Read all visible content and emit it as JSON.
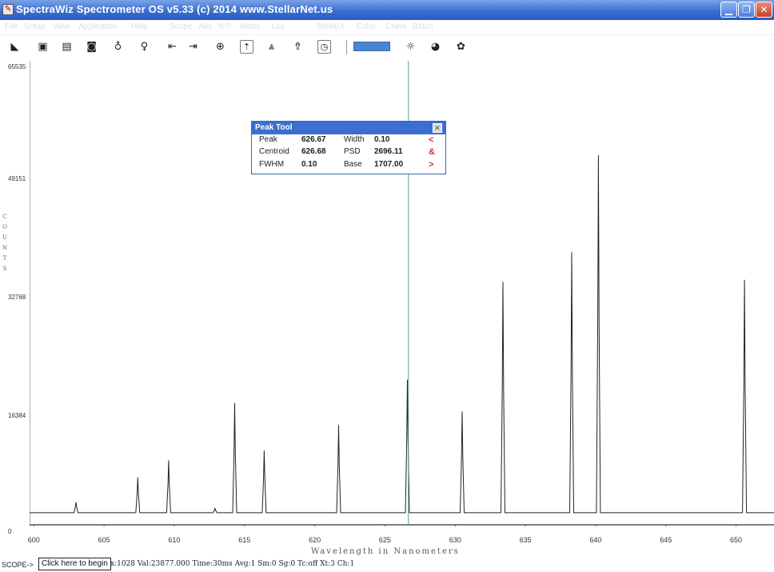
{
  "window": {
    "title": "SpectraWiz  Spectrometer OS v5.33 (c) 2014    www.StellarNet.us",
    "app_icon": "spectrawiz-icon",
    "controls": [
      "minimize-icon",
      "restore-icon",
      "close-icon"
    ]
  },
  "menu": {
    "items": [
      "File",
      "Setup",
      "View",
      "Application",
      "Help",
      "Scope",
      "Abs",
      "%Tr",
      "Watts",
      "Lux",
      "StellarX",
      "Color",
      "Chem",
      "Batch"
    ]
  },
  "toolbar": {
    "icons": [
      "open-file-icon",
      "save-icon",
      "print-icon",
      "camera-icon",
      "lamp-icon",
      "bulb-icon",
      "cursor-left-icon",
      "cursor-right-icon",
      "zoom-icon",
      "autoscale-y-icon",
      "peak-icon",
      "autoscale-icon",
      "timer-icon",
      "color-bar-icon",
      "sun-icon",
      "color-wheel-icon",
      "paint-icon"
    ]
  },
  "chart": {
    "ytick_labels": [
      "65535",
      "49151",
      "32768",
      "16384",
      "0"
    ],
    "ylabel_letters": "C\nO\nU\nN\nT\nS",
    "xtick_labels": [
      "600",
      "605",
      "610",
      "615",
      "620",
      "625",
      "630",
      "635",
      "640",
      "645",
      "650"
    ],
    "xlabel": "Wavelength in Nanometers"
  },
  "chart_data": {
    "type": "line",
    "xlabel": "Wavelength in Nanometers",
    "ylabel": "COUNTS",
    "xlim": [
      599.7,
      652.7
    ],
    "ylim": [
      0,
      65535
    ],
    "xticks": [
      600,
      605,
      610,
      615,
      620,
      625,
      630,
      635,
      640,
      645,
      650
    ],
    "yticks": [
      0,
      16384,
      32768,
      49151,
      65535
    ],
    "grid": false,
    "baseline": 1707,
    "cursor_x": 626.67,
    "series": [
      {
        "peaks": [
          {
            "x": 603.0,
            "y": 3200
          },
          {
            "x": 607.4,
            "y": 6700
          },
          {
            "x": 609.6,
            "y": 9100
          },
          {
            "x": 612.9,
            "y": 2300
          },
          {
            "x": 614.3,
            "y": 17200
          },
          {
            "x": 616.4,
            "y": 10500
          },
          {
            "x": 621.7,
            "y": 14100
          },
          {
            "x": 626.6,
            "y": 20500
          },
          {
            "x": 630.5,
            "y": 16000
          },
          {
            "x": 633.4,
            "y": 34300
          },
          {
            "x": 638.3,
            "y": 38500
          },
          {
            "x": 640.2,
            "y": 52200
          },
          {
            "x": 650.6,
            "y": 34600
          }
        ]
      }
    ]
  },
  "peak_tool": {
    "title": "Peak Tool",
    "close_icon": "close-icon",
    "rows": [
      {
        "label": "Peak",
        "value": "626.67",
        "label2": "Width",
        "value2": "0.10",
        "nav": "<"
      },
      {
        "label": "Centroid",
        "value": "626.68",
        "label2": "PSD",
        "value2": "2696.11",
        "nav": "&"
      },
      {
        "label": "FWHM",
        "value": "0.10",
        "label2": "Base",
        "value2": "1707.00",
        "nav": ">"
      }
    ]
  },
  "status": {
    "mode": "SCOPE->",
    "begin_button": "Click here to begin",
    "info": "x:1028  Val:23877.000  Time:30ms  Avg:1  Sm:0  Sg:0  Tc:off  Xt:3  Ch:1"
  }
}
